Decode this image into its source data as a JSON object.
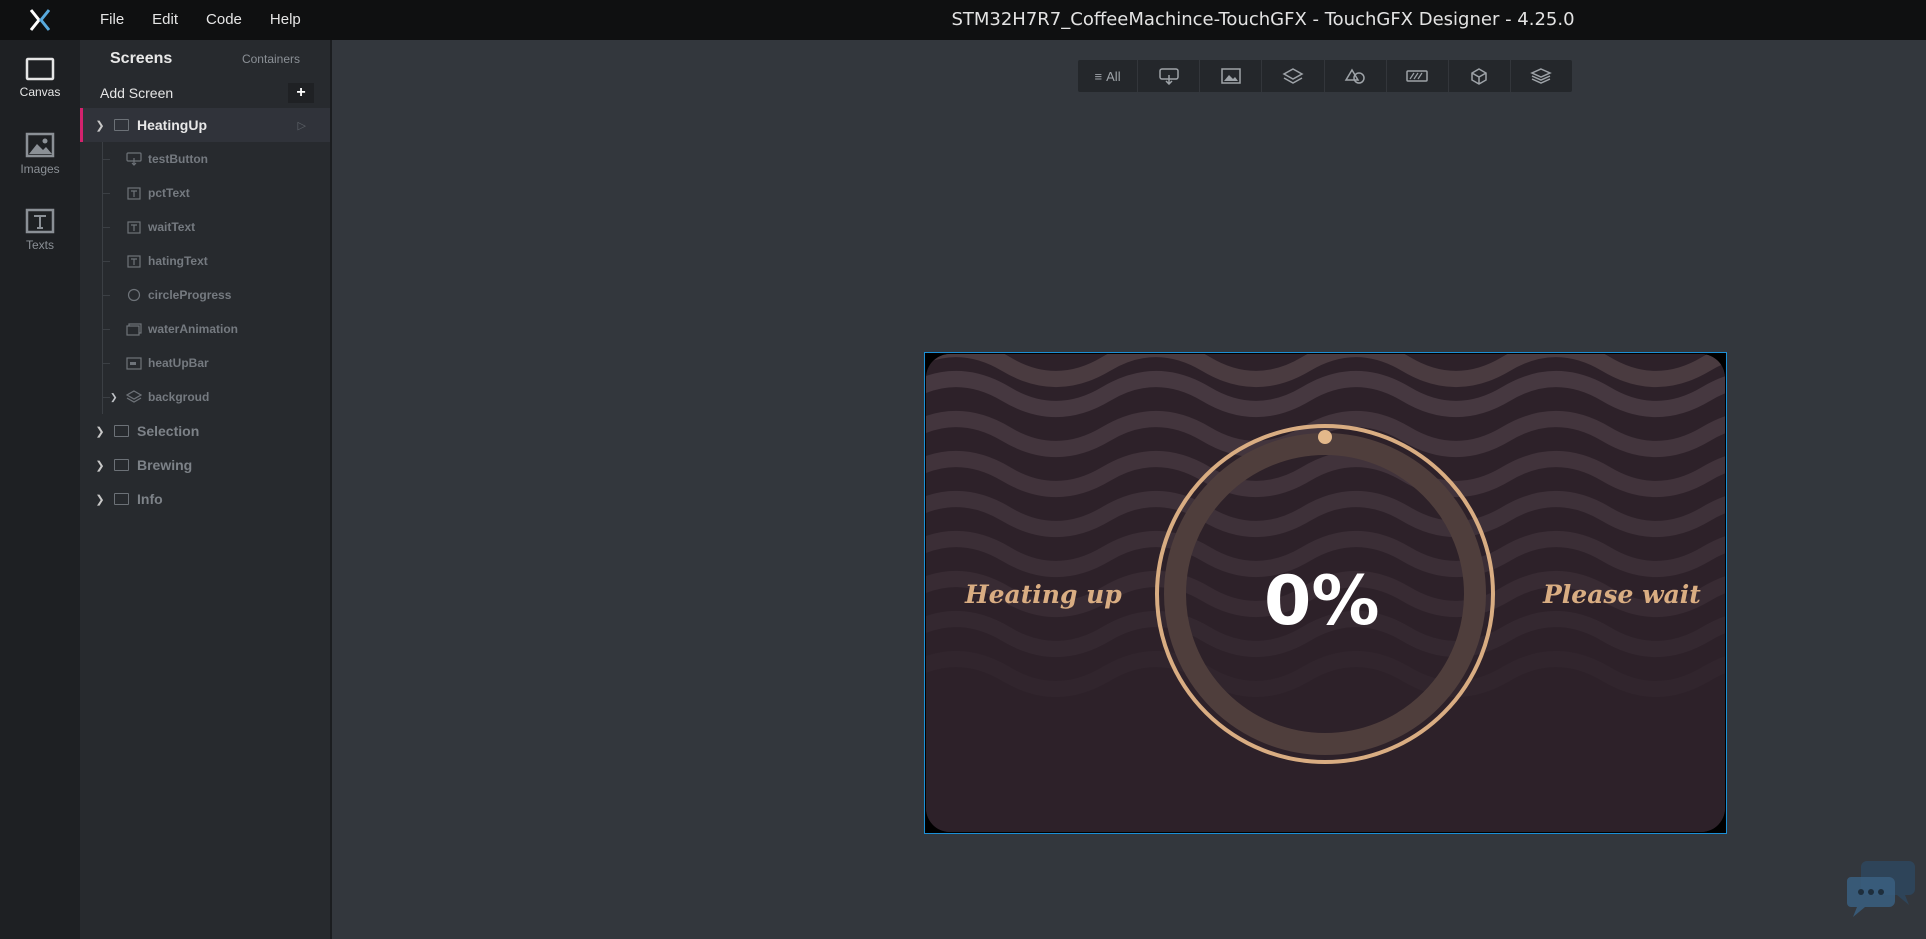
{
  "app": {
    "window_title": "STM32H7R7_CoffeeMachince-TouchGFX - TouchGFX Designer - 4.25.0"
  },
  "menu": {
    "items": [
      "File",
      "Edit",
      "Code",
      "Help"
    ]
  },
  "rail": {
    "items": [
      {
        "label": "Canvas",
        "icon": "canvas-icon"
      },
      {
        "label": "Images",
        "icon": "images-icon"
      },
      {
        "label": "Texts",
        "icon": "texts-icon"
      }
    ]
  },
  "panel": {
    "tab_screens": "Screens",
    "tab_containers": "Containers",
    "add_screen": "Add Screen",
    "add_symbol": "+",
    "active_screen": "HeatingUp",
    "children": [
      {
        "name": "testButton",
        "icon": "button-icon"
      },
      {
        "name": "pctText",
        "icon": "text-icon"
      },
      {
        "name": "waitText",
        "icon": "text-icon"
      },
      {
        "name": "hatingText",
        "icon": "text-icon"
      },
      {
        "name": "circleProgress",
        "icon": "circle-icon"
      },
      {
        "name": "waterAnimation",
        "icon": "animation-icon"
      },
      {
        "name": "heatUpBar",
        "icon": "progress-icon"
      },
      {
        "name": "backgroud",
        "icon": "layers-icon"
      }
    ],
    "other_screens": [
      "Selection",
      "Brewing",
      "Info"
    ]
  },
  "toolbar": {
    "all_label": "All",
    "filters": [
      "button-filter-icon",
      "image-filter-icon",
      "layer-filter-icon",
      "shape-filter-icon",
      "progress-filter-icon",
      "container-filter-icon",
      "stack-filter-icon"
    ]
  },
  "device": {
    "left_text": "Heating up",
    "right_text": "Please wait",
    "percent": "0%",
    "progress_value": 0,
    "accent": "#d9ad82",
    "selection_border": "#1b8fd6"
  }
}
